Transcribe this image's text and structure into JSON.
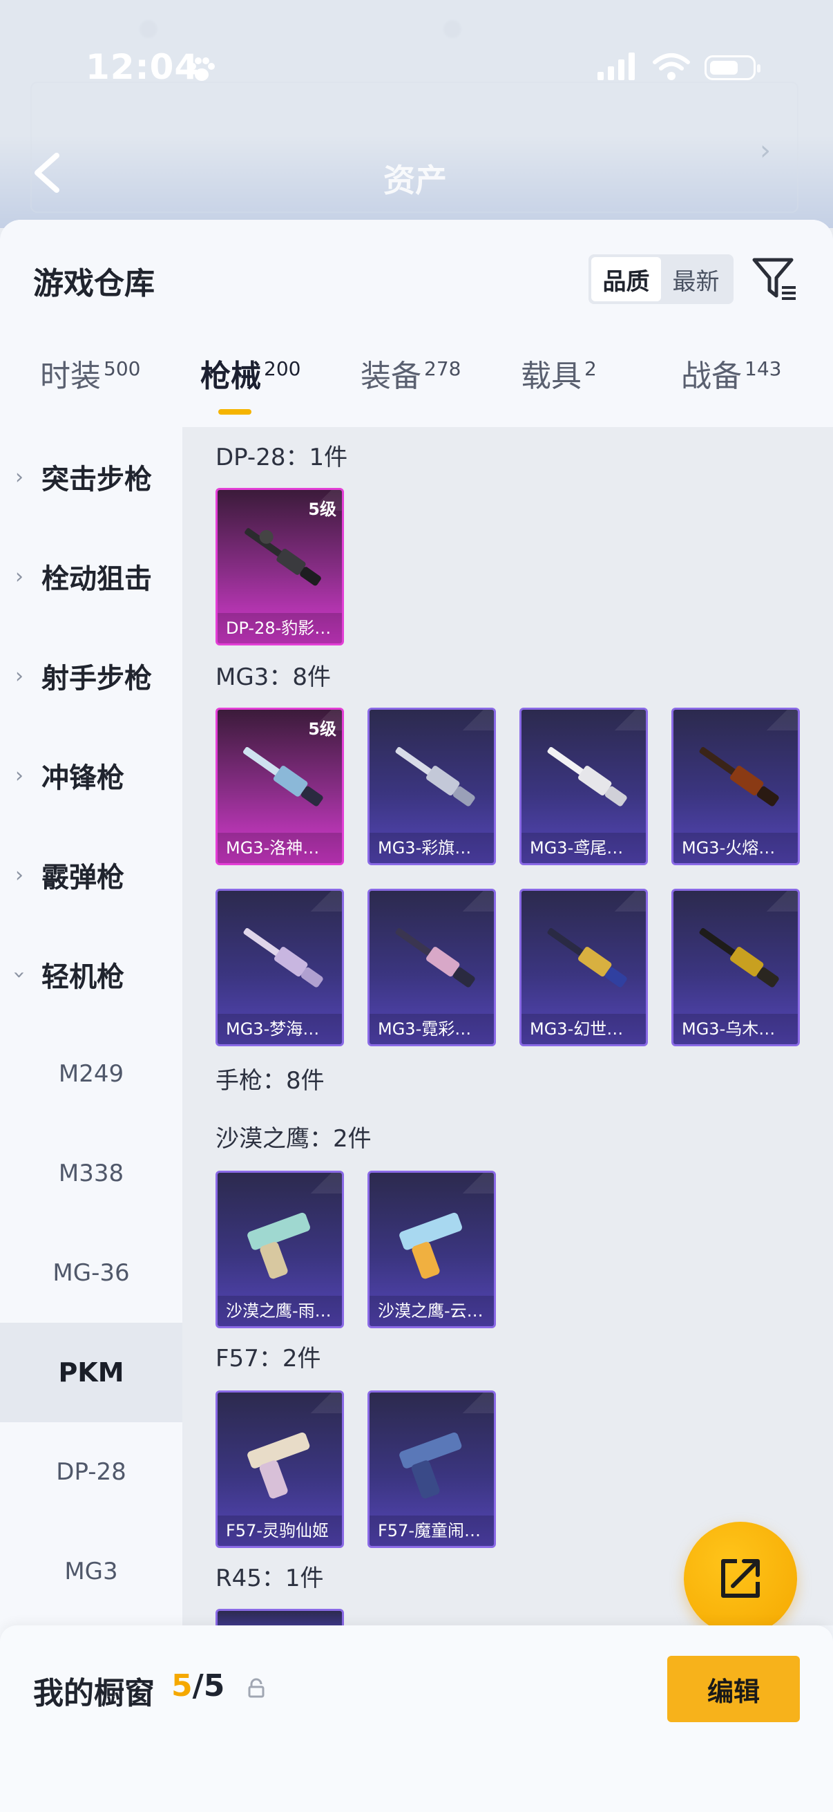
{
  "status": {
    "time": "12:04"
  },
  "header": {
    "asset_title": "资产"
  },
  "warehouse": {
    "title": "游戏仓库",
    "sort_options": [
      "品质",
      "最新"
    ],
    "active_sort": "品质"
  },
  "tabs": [
    {
      "label": "时装",
      "count": "500"
    },
    {
      "label": "枪械",
      "count": "200"
    },
    {
      "label": "装备",
      "count": "278"
    },
    {
      "label": "载具",
      "count": "2"
    },
    {
      "label": "战备",
      "count": "143"
    }
  ],
  "active_tab": "枪械",
  "categories": [
    {
      "label": "突击步枪"
    },
    {
      "label": "栓动狙击"
    },
    {
      "label": "射手步枪"
    },
    {
      "label": "冲锋枪"
    },
    {
      "label": "霰弹枪"
    },
    {
      "label": "轻机枪"
    }
  ],
  "subcategories": [
    "M249",
    "M338",
    "MG-36",
    "PKM",
    "DP-28",
    "MG3"
  ],
  "active_subcategory": "PKM",
  "groups": {
    "dp28": {
      "title": "DP-28：1件"
    },
    "mg3": {
      "title": "MG3：8件"
    },
    "pistol": {
      "title": "手枪：8件"
    },
    "deagle": {
      "title": "沙漠之鹰：2件"
    },
    "f57": {
      "title": "F57：2件"
    },
    "r45": {
      "title": "R45：1件"
    }
  },
  "items": {
    "dp28_1": {
      "name": "DP-28-豹影…",
      "level": "5级",
      "rarity": "pink"
    },
    "mg3_1": {
      "name": "MG3-洛神…",
      "level": "5级",
      "rarity": "pink"
    },
    "mg3_2": {
      "name": "MG3-彩旗…",
      "rarity": "purple"
    },
    "mg3_3": {
      "name": "MG3-鸢尾…",
      "rarity": "purple"
    },
    "mg3_4": {
      "name": "MG3-火熔…",
      "rarity": "purple"
    },
    "mg3_5": {
      "name": "MG3-梦海…",
      "rarity": "purple"
    },
    "mg3_6": {
      "name": "MG3-霓彩…",
      "rarity": "purple"
    },
    "mg3_7": {
      "name": "MG3-幻世…",
      "rarity": "purple"
    },
    "mg3_8": {
      "name": "MG3-乌木…",
      "rarity": "purple"
    },
    "de_1": {
      "name": "沙漠之鹰-雨…",
      "rarity": "purple"
    },
    "de_2": {
      "name": "沙漠之鹰-云…",
      "rarity": "purple"
    },
    "f57_1": {
      "name": "F57-灵驹仙姬",
      "rarity": "purple"
    },
    "f57_2": {
      "name": "F57-魔童闹…",
      "rarity": "purple"
    }
  },
  "bottom": {
    "window_label": "我的橱窗",
    "window_current": "5",
    "window_total": "/5",
    "edit_label": "编辑"
  },
  "colors": {
    "accent": "#f5b400",
    "pink_rarity": "#e33fd6",
    "purple_rarity": "#8a6ae6"
  }
}
